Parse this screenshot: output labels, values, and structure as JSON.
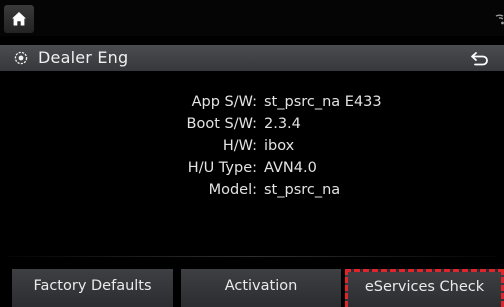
{
  "header": {
    "title": "Dealer Eng"
  },
  "icons": {
    "home": "home-icon",
    "settings": "settings-gear-icon",
    "back": "back-arrow-icon",
    "wifi": "wifi-signal-icon"
  },
  "info": {
    "app_sw_label": "App S/W:",
    "app_sw_value": "st_psrc_na E433",
    "boot_sw_label": "Boot S/W:",
    "boot_sw_value": "2.3.4",
    "hw_label": "H/W:",
    "hw_value": "ibox",
    "hu_type_label": "H/U Type:",
    "hu_type_value": "AVN4.0",
    "model_label": "Model:",
    "model_value": "st_psrc_na"
  },
  "buttons": {
    "factory_defaults": "Factory Defaults",
    "activation": "Activation",
    "eservices_check": "eServices Check"
  },
  "colors": {
    "highlight_border": "#e0242c",
    "button_bg": "#33353a"
  }
}
